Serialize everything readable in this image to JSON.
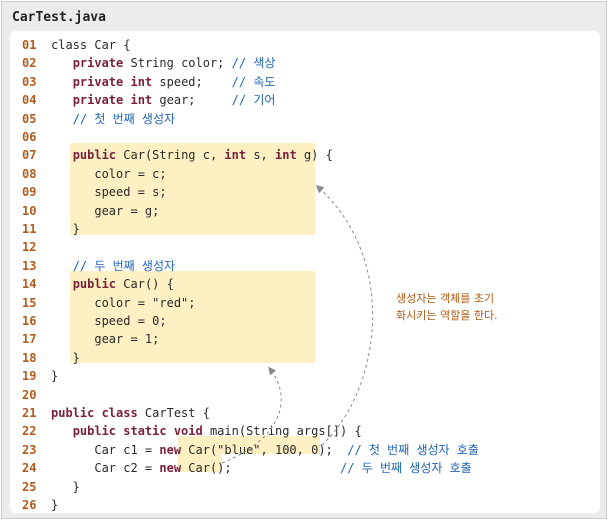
{
  "file_title": "CarTest.java",
  "lines": [
    {
      "n": "01",
      "parts": [
        {
          "t": "class Car {"
        }
      ]
    },
    {
      "n": "02",
      "parts": [
        {
          "t": "   "
        },
        {
          "t": "private",
          "c": "kw"
        },
        {
          "t": " String color; "
        },
        {
          "t": "// 색상",
          "c": "cm"
        }
      ]
    },
    {
      "n": "03",
      "parts": [
        {
          "t": "   "
        },
        {
          "t": "private int",
          "c": "kw"
        },
        {
          "t": " speed;    "
        },
        {
          "t": "// 속도",
          "c": "cm"
        }
      ]
    },
    {
      "n": "04",
      "parts": [
        {
          "t": "   "
        },
        {
          "t": "private int",
          "c": "kw"
        },
        {
          "t": " gear;     "
        },
        {
          "t": "// 기어",
          "c": "cm"
        }
      ]
    },
    {
      "n": "05",
      "parts": [
        {
          "t": "   "
        },
        {
          "t": "// 첫 번째 생성자",
          "c": "cm"
        }
      ]
    },
    {
      "n": "06",
      "parts": []
    },
    {
      "n": "07",
      "parts": [
        {
          "t": "   "
        },
        {
          "t": "public",
          "c": "kw"
        },
        {
          "t": " Car(String c, "
        },
        {
          "t": "int",
          "c": "kw"
        },
        {
          "t": " s, "
        },
        {
          "t": "int",
          "c": "kw"
        },
        {
          "t": " g) {"
        }
      ]
    },
    {
      "n": "08",
      "parts": [
        {
          "t": "      color = c;"
        }
      ]
    },
    {
      "n": "09",
      "parts": [
        {
          "t": "      speed = s;"
        }
      ]
    },
    {
      "n": "10",
      "parts": [
        {
          "t": "      gear = g;"
        }
      ]
    },
    {
      "n": "11",
      "parts": [
        {
          "t": "   }"
        }
      ]
    },
    {
      "n": "12",
      "parts": []
    },
    {
      "n": "13",
      "parts": [
        {
          "t": "   "
        },
        {
          "t": "// 두 번째 생성자",
          "c": "cm"
        }
      ]
    },
    {
      "n": "14",
      "parts": [
        {
          "t": "   "
        },
        {
          "t": "public",
          "c": "kw"
        },
        {
          "t": " Car() {"
        }
      ]
    },
    {
      "n": "15",
      "parts": [
        {
          "t": "      color = \"red\";"
        }
      ]
    },
    {
      "n": "16",
      "parts": [
        {
          "t": "      speed = 0;"
        }
      ]
    },
    {
      "n": "17",
      "parts": [
        {
          "t": "      gear = 1;"
        }
      ]
    },
    {
      "n": "18",
      "parts": [
        {
          "t": "   }"
        }
      ]
    },
    {
      "n": "19",
      "parts": [
        {
          "t": "}"
        }
      ]
    },
    {
      "n": "20",
      "parts": []
    },
    {
      "n": "21",
      "parts": [
        {
          "t": "public class",
          "c": "kw"
        },
        {
          "t": " CarTest {"
        }
      ]
    },
    {
      "n": "22",
      "parts": [
        {
          "t": "   "
        },
        {
          "t": "public static void",
          "c": "kw"
        },
        {
          "t": " main(String args[]) {"
        }
      ]
    },
    {
      "n": "23",
      "parts": [
        {
          "t": "      Car c1 = "
        },
        {
          "t": "new",
          "c": "kw"
        },
        {
          "t": " Car(\"blue\", 100, 0);  "
        },
        {
          "t": "// 첫 번째 생성자 호출",
          "c": "cm"
        }
      ]
    },
    {
      "n": "24",
      "parts": [
        {
          "t": "      Car c2 = "
        },
        {
          "t": "new",
          "c": "kw"
        },
        {
          "t": " Car();               "
        },
        {
          "t": "// 두 번째 생성자 호출",
          "c": "cm"
        }
      ]
    },
    {
      "n": "25",
      "parts": [
        {
          "t": "   }"
        }
      ]
    },
    {
      "n": "26",
      "parts": [
        {
          "t": "}"
        }
      ]
    }
  ],
  "annotation": {
    "line1": "생성자는 객체를 초기",
    "line2": "화시키는 역할을 한다."
  },
  "colors": {
    "line_number": "#b55a1d",
    "keyword": "#7a1f3a",
    "comment": "#2366b5",
    "highlight": "#fdf1c4",
    "annotation": "#b25a14",
    "arrow": "#8a8a8a"
  }
}
